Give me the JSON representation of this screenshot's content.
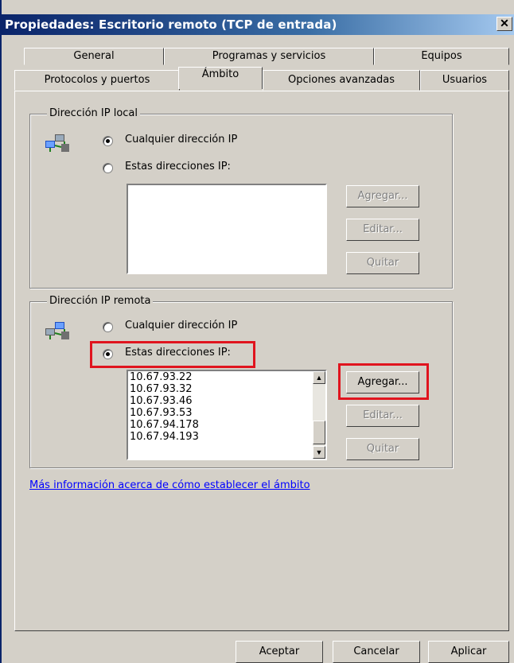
{
  "window": {
    "title": "Propiedades: Escritorio remoto (TCP de entrada)",
    "close_label": "✕"
  },
  "tabs_row1": [
    {
      "label": "General"
    },
    {
      "label": "Programas y servicios"
    },
    {
      "label": "Equipos"
    }
  ],
  "tabs_row2": [
    {
      "label": "Protocolos y puertos"
    },
    {
      "label": "Ámbito"
    },
    {
      "label": "Opciones avanzadas"
    },
    {
      "label": "Usuarios"
    }
  ],
  "active_tab": "Ámbito",
  "local_ip": {
    "group_label": "Dirección IP local",
    "option_any": "Cualquier dirección IP",
    "option_these": "Estas direcciones IP:",
    "selected": "any",
    "addresses": [],
    "buttons": {
      "add": "Agregar...",
      "edit": "Editar...",
      "remove": "Quitar"
    }
  },
  "remote_ip": {
    "group_label": "Dirección IP remota",
    "option_any": "Cualquier dirección IP",
    "option_these": "Estas direcciones IP:",
    "selected": "these",
    "addresses": [
      "10.67.93.22",
      "10.67.93.32",
      "10.67.93.46",
      "10.67.93.53",
      "10.67.94.178",
      "10.67.94.193"
    ],
    "buttons": {
      "add": "Agregar...",
      "edit": "Editar...",
      "remove": "Quitar"
    }
  },
  "help_link": "Más información acerca de cómo establecer el ámbito",
  "footer": {
    "ok": "Aceptar",
    "cancel": "Cancelar",
    "apply": "Aplicar"
  },
  "colors": {
    "highlight": "#e0141e",
    "title_gradient_start": "#0a246a",
    "dialog_bg": "#d4d0c8"
  }
}
